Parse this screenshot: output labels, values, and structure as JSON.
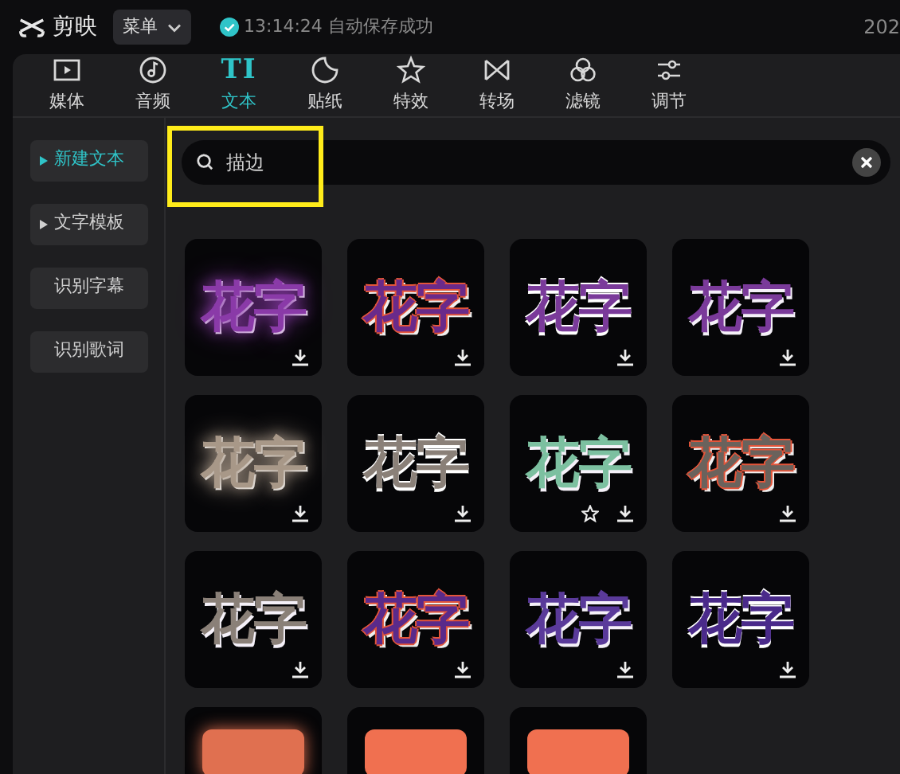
{
  "app": {
    "name": "剪映",
    "menu": "菜单",
    "save_status": "13:14:24 自动保存成功",
    "date_fragment": "202"
  },
  "tabs": [
    {
      "label": "媒体",
      "selected": false
    },
    {
      "label": "音频",
      "selected": false
    },
    {
      "label": "文本",
      "glyph": "TI",
      "selected": true
    },
    {
      "label": "贴纸",
      "selected": false
    },
    {
      "label": "特效",
      "selected": false
    },
    {
      "label": "转场",
      "selected": false
    },
    {
      "label": "滤镜",
      "selected": false
    },
    {
      "label": "调节",
      "selected": false
    }
  ],
  "sidebar": {
    "items": [
      {
        "label": "新建文本",
        "expandable": true,
        "selected": true
      },
      {
        "label": "文字模板",
        "expandable": true,
        "selected": false
      },
      {
        "label": "识别字幕",
        "expandable": false,
        "selected": false
      },
      {
        "label": "识别歌词",
        "expandable": false,
        "selected": false
      }
    ]
  },
  "search": {
    "value": "描边",
    "highlighted": true
  },
  "tiles": [
    {
      "text": "花字",
      "kind": "glow",
      "color": "#8a3aa8",
      "downloadable": true,
      "starred": false
    },
    {
      "text": "花字",
      "kind": "stroke",
      "color": "#6a2a8a",
      "downloadable": true,
      "starred": false
    },
    {
      "text": "花字",
      "kind": "stripes",
      "color": "#7a3a9a",
      "downloadable": true,
      "starred": false
    },
    {
      "text": "花字",
      "kind": "gradient",
      "color": "#7a3a9a",
      "downloadable": true,
      "starred": false
    },
    {
      "text": "花字",
      "kind": "glow",
      "color": "#a89888",
      "downloadable": true,
      "starred": false
    },
    {
      "text": "花字",
      "kind": "stripes",
      "color": "#8a8078",
      "downloadable": true,
      "starred": false
    },
    {
      "text": "花字",
      "kind": "gradient",
      "color": "#7cc0a0",
      "downloadable": true,
      "starred": true
    },
    {
      "text": "花字",
      "kind": "stroke",
      "color": "#6a625c",
      "downloadable": true,
      "starred": false
    },
    {
      "text": "花字",
      "kind": "gradient",
      "color": "#8a8078",
      "downloadable": true,
      "starred": false
    },
    {
      "text": "花字",
      "kind": "stroke",
      "color": "#5a2a8a",
      "downloadable": true,
      "starred": false
    },
    {
      "text": "花字",
      "kind": "gradient",
      "color": "#5a3a9a",
      "downloadable": true,
      "starred": false
    },
    {
      "text": "花字",
      "kind": "stripes",
      "color": "#4a2a8a",
      "downloadable": true,
      "starred": false
    },
    {
      "kind": "glow",
      "color": "#e07050",
      "downloadable": false,
      "starred": false
    },
    {
      "kind": "plain",
      "color": "#f07050",
      "downloadable": false,
      "starred": false
    },
    {
      "kind": "plain",
      "color": "#f07050",
      "downloadable": false,
      "starred": false
    }
  ]
}
